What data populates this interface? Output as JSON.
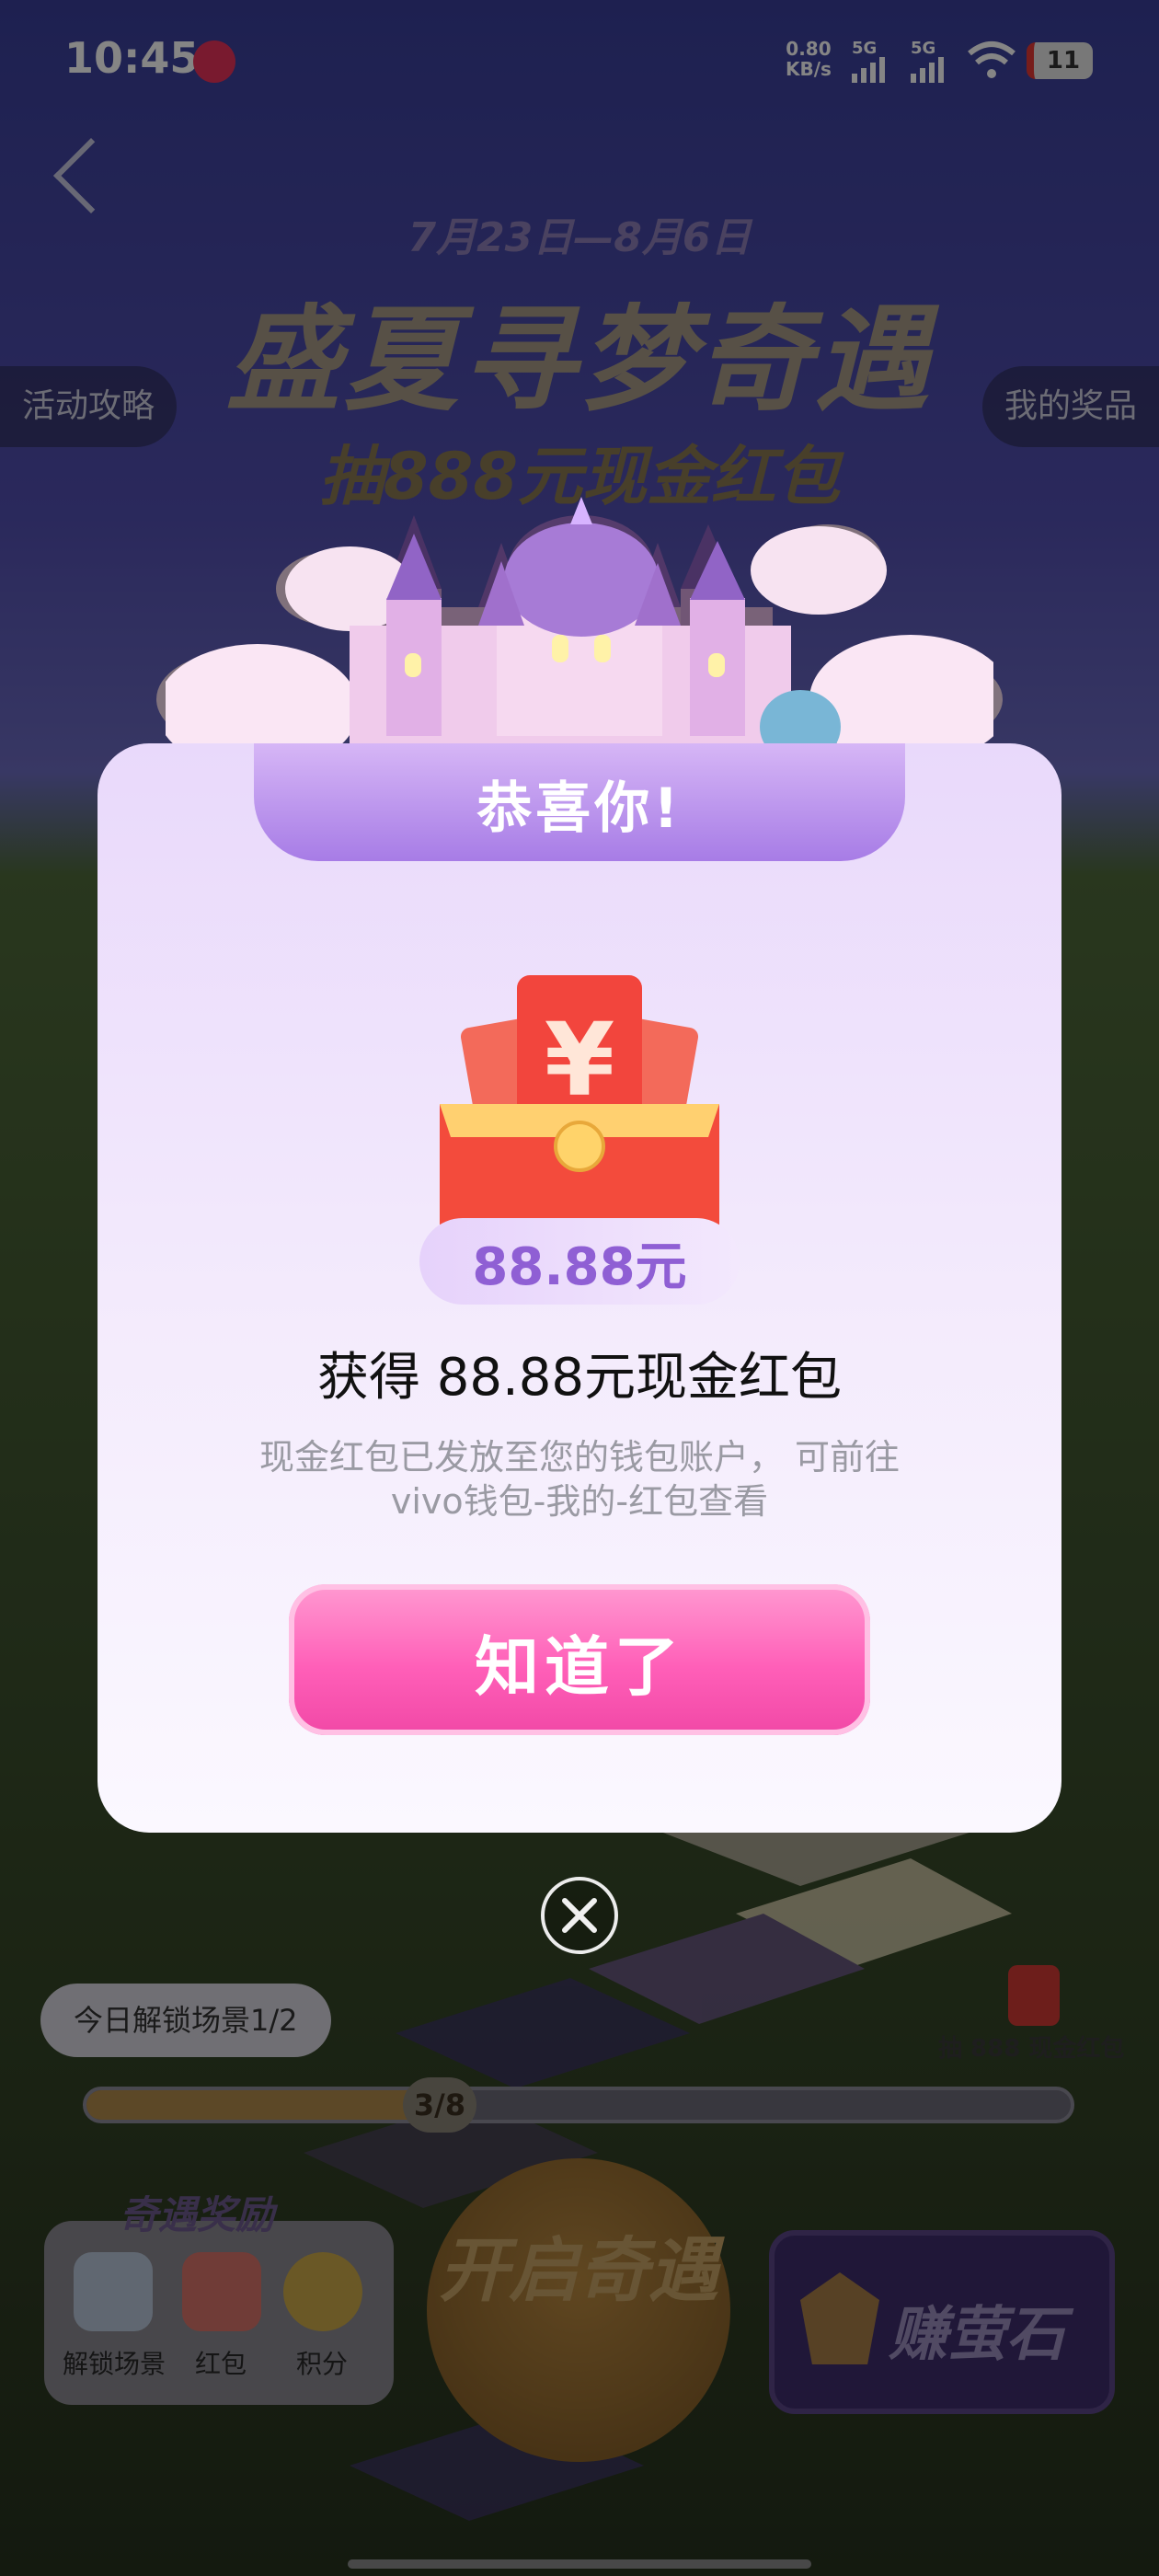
{
  "status_bar": {
    "time": "10:45",
    "speed_value": "0.80",
    "speed_unit": "KB/s",
    "net1": "5G",
    "net2": "5G",
    "battery": "11"
  },
  "header": {
    "date_range": "7月23日—8月6日",
    "title": "盛夏寻梦奇遇",
    "subtitle": "抽888元现金红包",
    "left_button": "活动攻略",
    "right_button": "我的奖品"
  },
  "bottom": {
    "unlock_today": "今日解锁场景1/2",
    "progress_label": "3/8",
    "progress_fraction": 0.375,
    "reward_title": "奇遇奖励",
    "rewards": [
      "解锁场景",
      "红包",
      "积分"
    ],
    "start_button": "开启奇遇",
    "earn_button": "赚萤石",
    "prize_label": "抽 888 现金红包"
  },
  "dialog": {
    "title": "恭喜你!",
    "amount": "88.88元",
    "got_text": "获得 88.88元现金红包",
    "desc_line1": "现金红包已发放至您的钱包账户， 可前往",
    "desc_line2": "vivo钱包-我的-红包查看",
    "ok_button": "知道了"
  },
  "colors": {
    "accent_pink": "#ff5fb8",
    "accent_purple": "#a77ce6",
    "amount_purple": "#8f5fd4",
    "envelope_red": "#f2453d"
  }
}
